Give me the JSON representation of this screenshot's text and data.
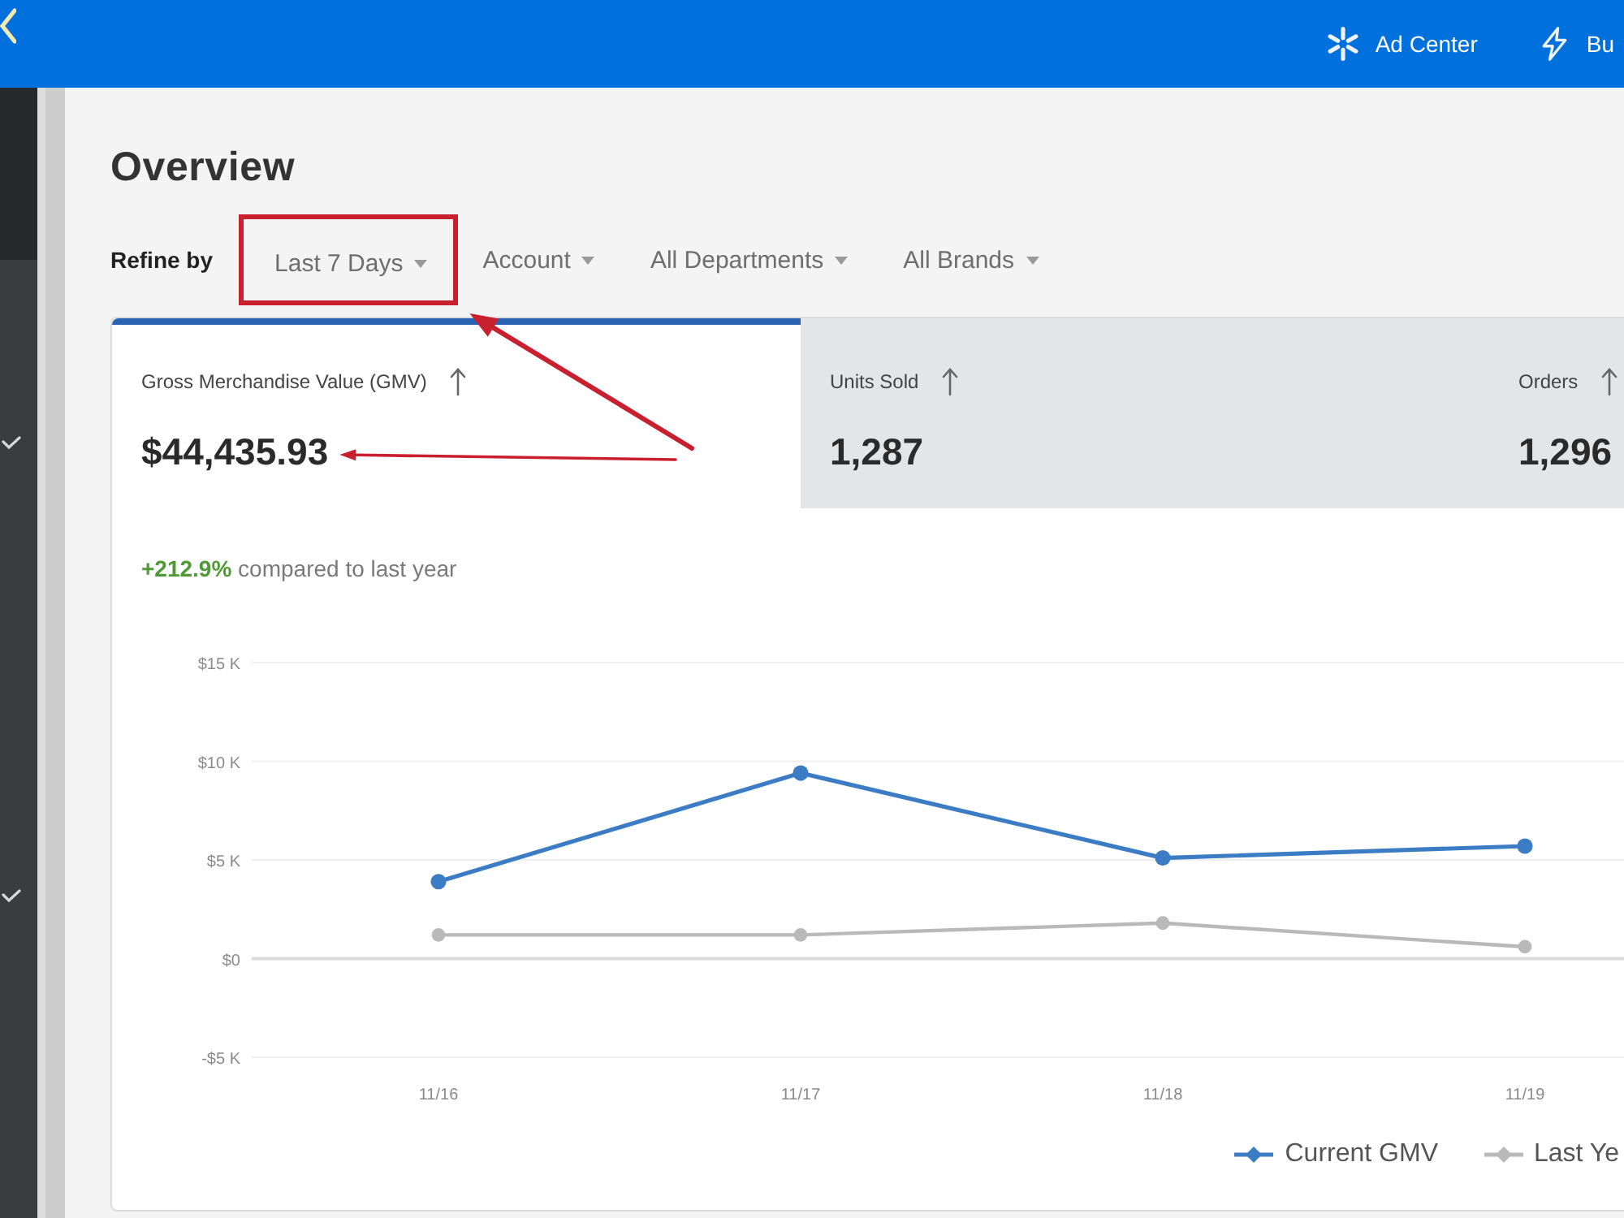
{
  "topbar": {
    "links": [
      {
        "kind": "spark",
        "label": "Ad Center"
      },
      {
        "kind": "bolt",
        "label": "Bu"
      }
    ]
  },
  "page": {
    "title": "Overview"
  },
  "refine": {
    "label": "Refine by",
    "filters": [
      {
        "label": "Last 7 Days",
        "highlighted": true
      },
      {
        "label": "Account",
        "highlighted": false
      },
      {
        "label": "All Departments",
        "highlighted": false
      },
      {
        "label": "All Brands",
        "highlighted": false
      }
    ]
  },
  "metrics": [
    {
      "label": "Gross Merchandise Value (GMV)",
      "value": "$44,435.93",
      "selected": true,
      "highlighted": true
    },
    {
      "label": "Units Sold",
      "value": "1,287",
      "selected": false,
      "highlighted": false
    },
    {
      "label": "Orders",
      "value": "1,296",
      "selected": false,
      "highlighted": false
    }
  ],
  "comparison": "**+212.9%** compared to last year",
  "chart_data": {
    "type": "line",
    "categories": [
      "11/16",
      "11/17",
      "11/18",
      "11/19"
    ],
    "ylim": [
      -5000,
      15000
    ],
    "yticks": [
      {
        "value": -5000,
        "label": "-$5 K"
      },
      {
        "value": 0,
        "label": "$0"
      },
      {
        "value": 5000,
        "label": "$5 K"
      },
      {
        "value": 10000,
        "label": "$10 K"
      },
      {
        "value": 15000,
        "label": "$15 K"
      }
    ],
    "grid": true,
    "legend": "bottom",
    "series": [
      {
        "name": "Current GMV",
        "color": "#3b7cc4",
        "marker": "circle",
        "values": [
          3900,
          9400,
          5100,
          5700
        ]
      },
      {
        "name": "Last Ye",
        "color": "#b9b9b9",
        "marker": "circle",
        "values": [
          1200,
          1200,
          1800,
          600
        ]
      }
    ]
  }
}
